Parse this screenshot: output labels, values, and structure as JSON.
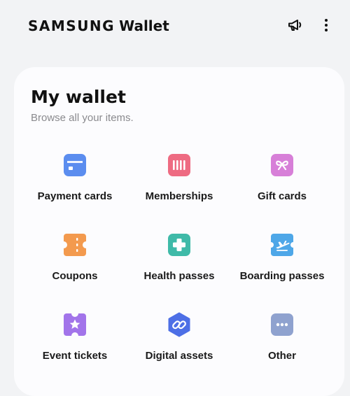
{
  "header": {
    "brand_samsung": "SAMSUNG",
    "brand_wallet": "Wallet",
    "announce_icon": "megaphone-icon",
    "more_icon": "more-vertical-icon"
  },
  "wallet": {
    "title": "My wallet",
    "subtitle": "Browse all your items."
  },
  "categories": [
    {
      "label": "Payment cards",
      "icon": "payment-card-icon",
      "color": "#5b8def"
    },
    {
      "label": "Memberships",
      "icon": "membership-barcode-icon",
      "color": "#ee6b82"
    },
    {
      "label": "Gift cards",
      "icon": "gift-ribbon-icon",
      "color": "#d77fd8"
    },
    {
      "label": "Coupons",
      "icon": "coupon-icon",
      "color": "#f39a4e"
    },
    {
      "label": "Health passes",
      "icon": "health-plus-icon",
      "color": "#3fbaa8"
    },
    {
      "label": "Boarding passes",
      "icon": "airplane-ticket-icon",
      "color": "#4ea7e8"
    },
    {
      "label": "Event tickets",
      "icon": "star-ticket-icon",
      "color": "#a274ea"
    },
    {
      "label": "Digital assets",
      "icon": "link-hexagon-icon",
      "color": "#4d6fe6"
    },
    {
      "label": "Other",
      "icon": "ellipsis-icon",
      "color": "#8fa2cf"
    }
  ]
}
